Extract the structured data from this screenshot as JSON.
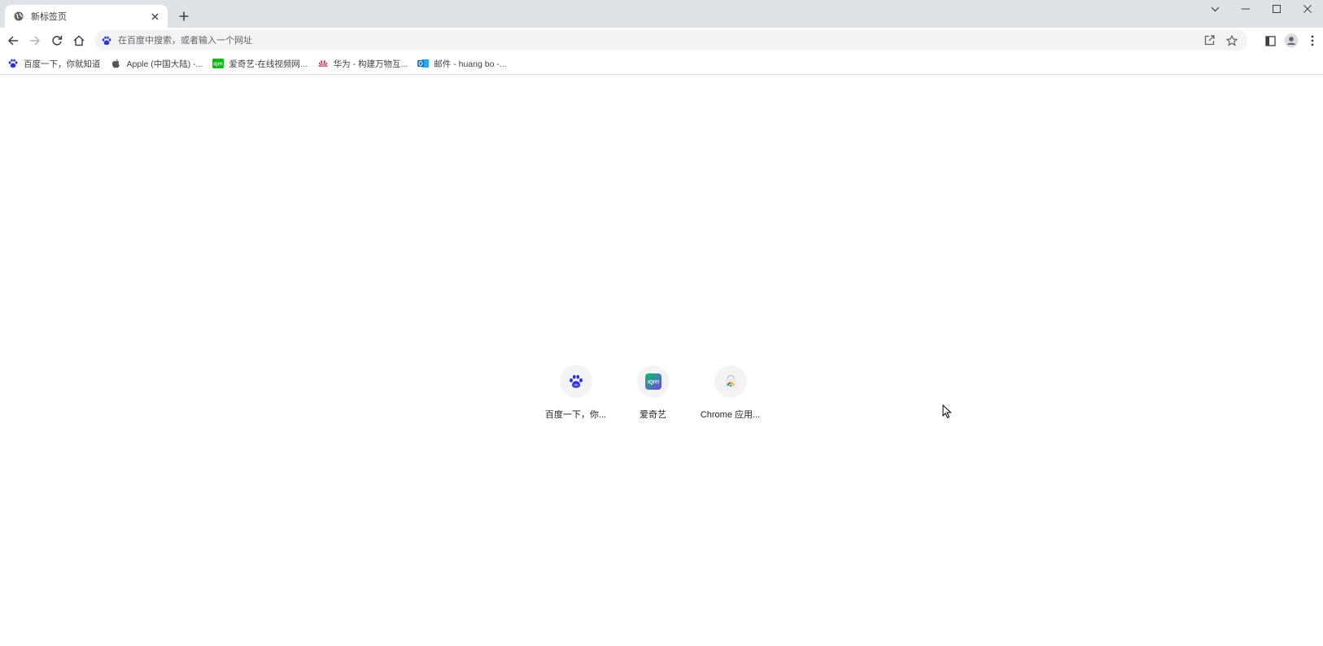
{
  "tab": {
    "title": "新标签页",
    "favicon": "globe-icon",
    "close_icon": "close-icon"
  },
  "window_controls": [
    "tab-search-icon",
    "minimize-icon",
    "maximize-icon",
    "close-icon"
  ],
  "omnibox": {
    "placeholder": "在百度中搜索，或者输入一个网址",
    "value": ""
  },
  "bookmarks": [
    {
      "label": "百度一下，你就知道",
      "icon": "baidu-icon"
    },
    {
      "label": "Apple (中国大陆) -...",
      "icon": "apple-icon"
    },
    {
      "label": "爱奇艺-在线视频网...",
      "icon": "iqiyi-icon"
    },
    {
      "label": "华为 - 构建万物互...",
      "icon": "huawei-icon"
    },
    {
      "label": "邮件 - huang bo -...",
      "icon": "outlook-icon"
    }
  ],
  "shortcuts": [
    {
      "label": "百度一下，你...",
      "icon": "baidu-icon"
    },
    {
      "label": "爱奇艺",
      "icon": "iqiyi-icon"
    },
    {
      "label": "Chrome 应用...",
      "icon": "chrome-webstore-icon"
    }
  ],
  "colors": {
    "tabstrip": "#dee1e6",
    "omnibox": "#f1f3f4",
    "baidu_blue": "#2932e1",
    "iqiyi_green": "#00be06",
    "huawei_red": "#cf0a2c",
    "outlook_blue": "#0078d4"
  }
}
